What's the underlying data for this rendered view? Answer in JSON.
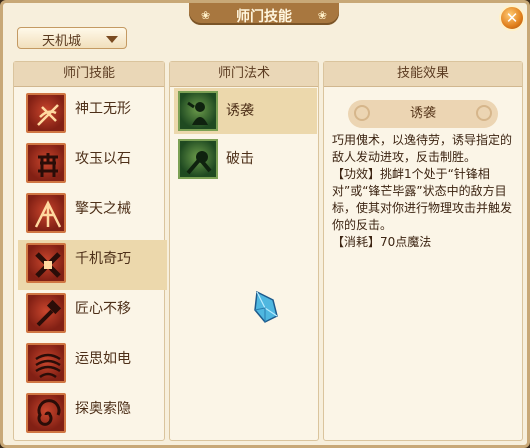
{
  "window": {
    "title": "师门技能",
    "close_label": "✕"
  },
  "dropdown": {
    "selected": "天机城"
  },
  "skills_panel": {
    "header": "师门技能",
    "items": [
      {
        "label": "神工无形",
        "icon": "craftsman-icon"
      },
      {
        "label": "攻玉以石",
        "icon": "jade-icon"
      },
      {
        "label": "擎天之械",
        "icon": "machine-icon"
      },
      {
        "label": "千机奇巧",
        "icon": "cross-tools-icon",
        "selected": true
      },
      {
        "label": "匠心不移",
        "icon": "hammer-icon"
      },
      {
        "label": "运思如电",
        "icon": "swirl-icon"
      },
      {
        "label": "探奥索隐",
        "icon": "vortex-icon"
      }
    ]
  },
  "magic_panel": {
    "header": "师门法术",
    "items": [
      {
        "label": "诱袭",
        "icon": "lure-icon",
        "selected": true
      },
      {
        "label": "破击",
        "icon": "strike-icon"
      }
    ]
  },
  "effect_panel": {
    "header": "技能效果",
    "skill_name": "诱袭",
    "description": "巧用傀术，以逸待劳，诱导指定的敌人发动进攻，反击制胜。\n【功效】挑衅1个处于“针锋相对”或“锋芒毕露”状态中的敌方目标，使其对你进行物理攻击并触发你的反击。\n【消耗】70点魔法"
  },
  "colors": {
    "background": "#f7efdc",
    "title_bar": "#a8773f",
    "selected_row": "#ecd8ac"
  }
}
